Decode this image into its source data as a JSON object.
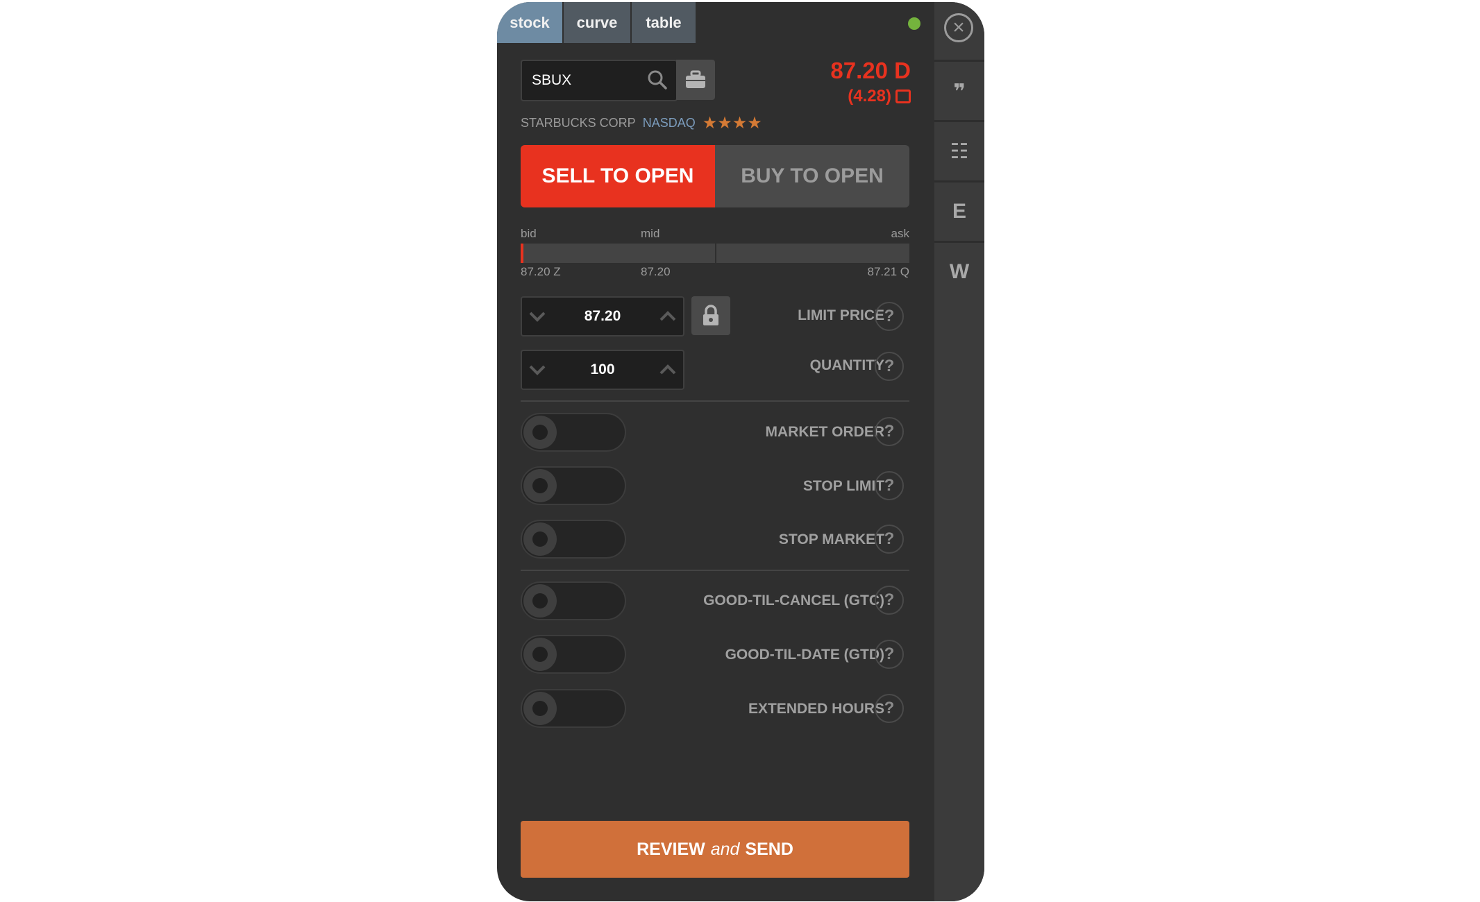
{
  "tabs": [
    {
      "label": "stock",
      "active": true
    },
    {
      "label": "curve",
      "active": false
    },
    {
      "label": "table",
      "active": false
    }
  ],
  "status_color": "#74b33d",
  "side_nav": {
    "close_icon": "close-icon",
    "items": [
      {
        "name": "quote",
        "icon": "quote-icon",
        "glyph": "❞"
      },
      {
        "name": "list",
        "icon": "list-icon",
        "glyph": "☷"
      },
      {
        "name": "e",
        "glyph": "E"
      },
      {
        "name": "w",
        "glyph": "W"
      }
    ]
  },
  "search": {
    "value": "SBUX"
  },
  "quote": {
    "price": "87.20 D",
    "change": "(4.28)",
    "company": "STARBUCKS CORP",
    "exchange": "NASDAQ",
    "stars": "★★★★",
    "rating": 4
  },
  "order_side": {
    "sell": "SELL TO OPEN",
    "buy": "BUY TO OPEN",
    "selected": "sell"
  },
  "range": {
    "bid_label": "bid",
    "mid_label": "mid",
    "ask_label": "ask",
    "bid": "87.20 Z",
    "mid": "87.20",
    "ask": "87.21 Q"
  },
  "limit_price": {
    "value": "87.20",
    "label": "LIMIT PRICE"
  },
  "quantity": {
    "value": "100",
    "label": "QUANTITY"
  },
  "toggles": {
    "market_order": "MARKET ORDER",
    "stop_limit": "STOP LIMIT",
    "stop_market": "STOP MARKET",
    "gtc": "GOOD-TIL-CANCEL (GTC)",
    "gtd": "GOOD-TIL-DATE (GTD)",
    "extended": "EXTENDED HOURS"
  },
  "help": "?",
  "review": {
    "part1": "REVIEW",
    "part2": "and",
    "part3": "SEND"
  },
  "colors": {
    "sell": "#e8321f",
    "review": "#d0703a",
    "active_tab": "#6e8ba3"
  }
}
